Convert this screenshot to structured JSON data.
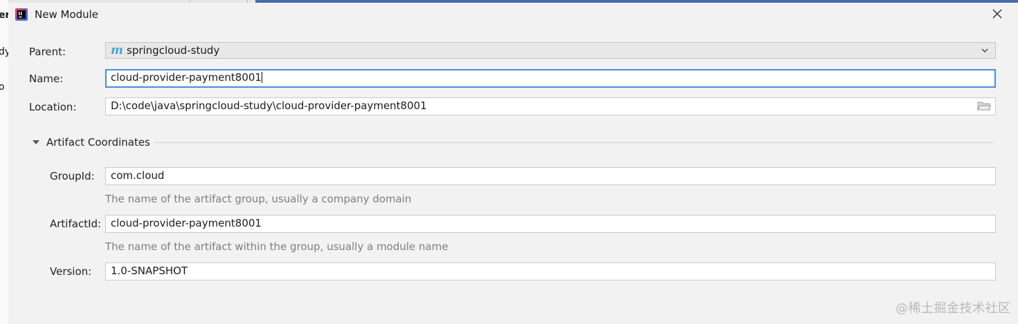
{
  "background": {
    "left_fragments": [
      "er",
      "dy",
      "o"
    ]
  },
  "dialog": {
    "title": "New Module",
    "icons": {
      "app": "intellij-icon",
      "close": "close-icon"
    }
  },
  "form": {
    "parent_label": "Parent:",
    "parent_value": "springcloud-study",
    "parent_icon_glyph": "m",
    "name_label": "Name:",
    "name_value": "cloud-provider-payment8001",
    "location_label": "Location:",
    "location_value": "D:\\code\\java\\springcloud-study\\cloud-provider-payment8001"
  },
  "artifact": {
    "section_title": "Artifact Coordinates",
    "expanded": true,
    "group_label": "GroupId:",
    "group_value": "com.cloud",
    "group_hint": "The name of the artifact group, usually a company domain",
    "artifact_label": "ArtifactId:",
    "artifact_value": "cloud-provider-payment8001",
    "artifact_hint": "The name of the artifact within the group, usually a module name",
    "version_label": "Version:",
    "version_value": "1.0-SNAPSHOT"
  },
  "watermark": "@稀土掘金技术社区",
  "colors": {
    "focus_border": "#4b8ad6",
    "maven_icon": "#47a5d3",
    "dialog_bg": "#f2f2f2"
  }
}
